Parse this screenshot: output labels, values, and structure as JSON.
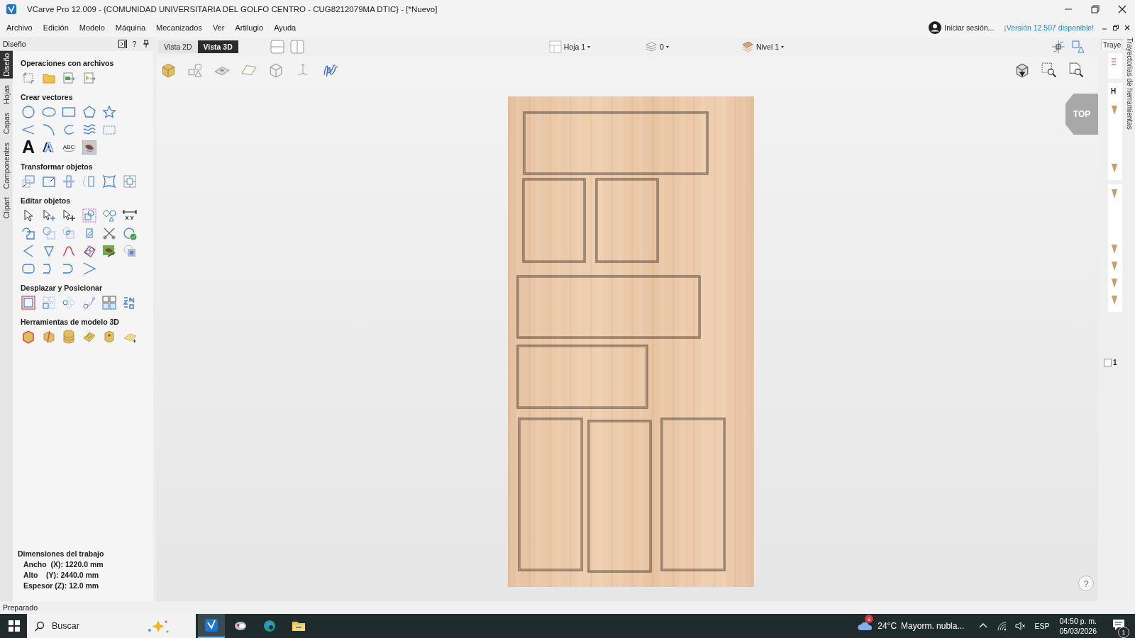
{
  "window": {
    "title": "VCarve Pro 12.009 - {COMUNIDAD UNIVERSITARIA DEL GOLFO CENTRO - CUG8212079MA DTIC} - [*Nuevo]"
  },
  "menu": [
    "Archivo",
    "Edición",
    "Modelo",
    "Máquina",
    "Mecanizados",
    "Ver",
    "Artilugio",
    "Ayuda"
  ],
  "account": {
    "label": "Iniciar sesión...",
    "update_link": "¡Versión 12.507 disponible!"
  },
  "design_panel": {
    "title": "Diseño",
    "help": "?",
    "side_tabs": [
      {
        "label": "Diseño",
        "selected": true
      },
      {
        "label": "Hojas",
        "selected": false
      },
      {
        "label": "Capas",
        "selected": false
      },
      {
        "label": "Componentes",
        "selected": false
      },
      {
        "label": "Clipart",
        "selected": false
      }
    ],
    "sections": [
      {
        "title": "Operaciones con archivos"
      },
      {
        "title": "Crear vectores",
        "glyphs": [
          "A",
          "A",
          "ABC"
        ]
      },
      {
        "title": "Transformar objetos"
      },
      {
        "title": "Editar objetos",
        "glyphs": [
          "X Y"
        ]
      },
      {
        "title": "Desplazar y Posicionar"
      },
      {
        "title": "Herramientas de modelo 3D"
      }
    ],
    "job": {
      "title": "Dimensiones del trabajo",
      "lines": [
        "Ancho  (X): 1220.0 mm",
        "Alto    (Y): 2440.0 mm",
        "Espesor (Z): 12.0 mm"
      ]
    }
  },
  "view": {
    "tabs": [
      {
        "label": "Vista 2D",
        "selected": false
      },
      {
        "label": "Vista 3D",
        "selected": true
      }
    ],
    "sheet": "Hoja 1",
    "count": "0",
    "level": "Nivel 1",
    "cube": "TOP",
    "help": "?"
  },
  "toolpaths": {
    "tab": "Traye",
    "title": "Trayectorias de herramientas",
    "heading": "H",
    "item": "1",
    "checked": false
  },
  "status_bar": "Preparado",
  "taskbar": {
    "search": {
      "placeholder": "Buscar"
    },
    "weather": {
      "badge": "8",
      "temperature": "24°C",
      "text": "Mayorm. nubla..."
    },
    "language": "ESP",
    "time": "04:50 p. m.",
    "date": "05/03/2026",
    "notifications": "1"
  }
}
